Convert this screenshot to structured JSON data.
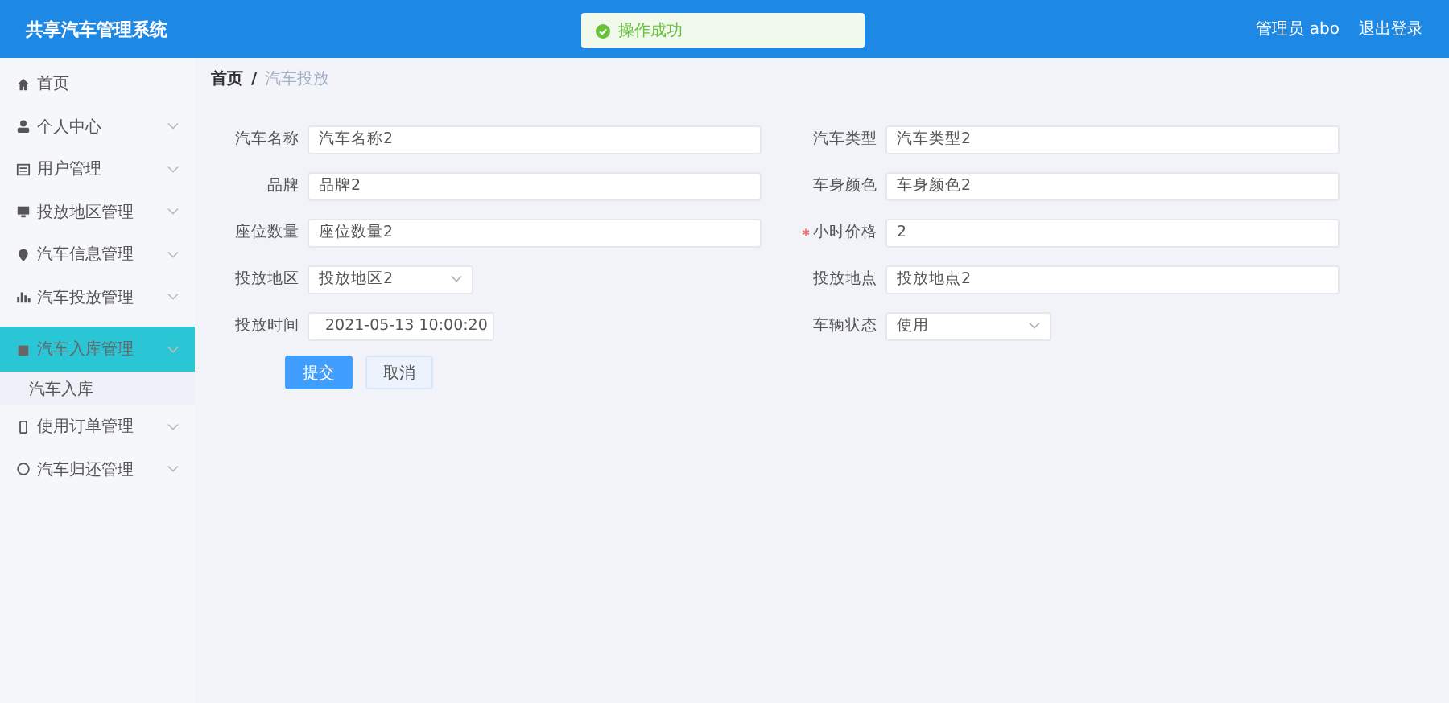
{
  "header": {
    "title": "共享汽车管理系统",
    "user": "管理员 abo",
    "logout": "退出登录"
  },
  "toast": {
    "message": "操作成功"
  },
  "sidebar": {
    "items": [
      {
        "label": "首页",
        "expandable": false,
        "selected": false
      },
      {
        "label": "个人中心",
        "expandable": true,
        "selected": false
      },
      {
        "label": "用户管理",
        "expandable": true,
        "selected": false
      },
      {
        "label": "投放地区管理",
        "expandable": true,
        "selected": false
      },
      {
        "label": "汽车信息管理",
        "expandable": true,
        "selected": false
      },
      {
        "label": "汽车投放管理",
        "expandable": true,
        "selected": false
      },
      {
        "label": "汽车入库管理",
        "expandable": true,
        "selected": true,
        "children": [
          {
            "label": "汽车入库"
          }
        ]
      },
      {
        "label": "使用订单管理",
        "expandable": true,
        "selected": false
      },
      {
        "label": "汽车归还管理",
        "expandable": true,
        "selected": false
      }
    ]
  },
  "breadcrumb": {
    "items": [
      "首页",
      "汽车投放"
    ],
    "separator": "/"
  },
  "form": {
    "left": [
      {
        "label": "汽车名称",
        "kind": "input",
        "value": "汽车名称2",
        "required": false
      },
      {
        "label": "品牌",
        "kind": "input",
        "value": "品牌2",
        "required": false
      },
      {
        "label": "座位数量",
        "kind": "input",
        "value": "座位数量2",
        "required": false
      },
      {
        "label": "投放地区",
        "kind": "select",
        "value": "投放地区2",
        "required": false
      },
      {
        "label": "投放时间",
        "kind": "date",
        "value": "2021-05-13 10:00:20",
        "required": false
      }
    ],
    "right": [
      {
        "label": "汽车类型",
        "kind": "input",
        "value": "汽车类型2",
        "required": false
      },
      {
        "label": "车身颜色",
        "kind": "input",
        "value": "车身颜色2",
        "required": false
      },
      {
        "label": "小时价格",
        "kind": "input",
        "value": "2",
        "required": true
      },
      {
        "label": "投放地点",
        "kind": "input",
        "value": "投放地点2",
        "required": false
      },
      {
        "label": "车辆状态",
        "kind": "select",
        "value": "使用",
        "required": false
      }
    ],
    "buttons": [
      {
        "label": "提交",
        "kind": "primary"
      },
      {
        "label": "取消",
        "kind": "default"
      }
    ]
  }
}
